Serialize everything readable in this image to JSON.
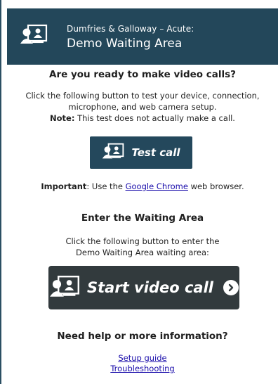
{
  "header": {
    "subtitle": "Dumfries & Galloway – Acute:",
    "title": "Demo Waiting Area"
  },
  "ready": {
    "heading": "Are you ready to make video calls?",
    "line1": "Click the following button to test your device, connection,",
    "line2": "microphone, and web camera setup.",
    "note_label": "Note:",
    "note_text": " This test does not actually make a call."
  },
  "test_button": {
    "label": "Test call"
  },
  "important": {
    "label": "Important",
    "prefix": ": Use the ",
    "link": "Google Chrome",
    "suffix": " web browser."
  },
  "enter": {
    "heading": "Enter the Waiting Area",
    "line1": "Click the following button to enter the",
    "line2": "Demo Waiting Area waiting area:"
  },
  "start_button": {
    "label": "Start video call"
  },
  "help": {
    "heading": "Need help or more information?",
    "links": [
      "Setup guide",
      "Troubleshooting"
    ]
  },
  "colors": {
    "header_bg": "#23475a",
    "test_button_bg": "#24485c",
    "start_button_bg": "#323a3d",
    "link": "#1a0dab"
  },
  "icons": [
    "video-call-people-icon",
    "arrow-right-circle-icon"
  ]
}
